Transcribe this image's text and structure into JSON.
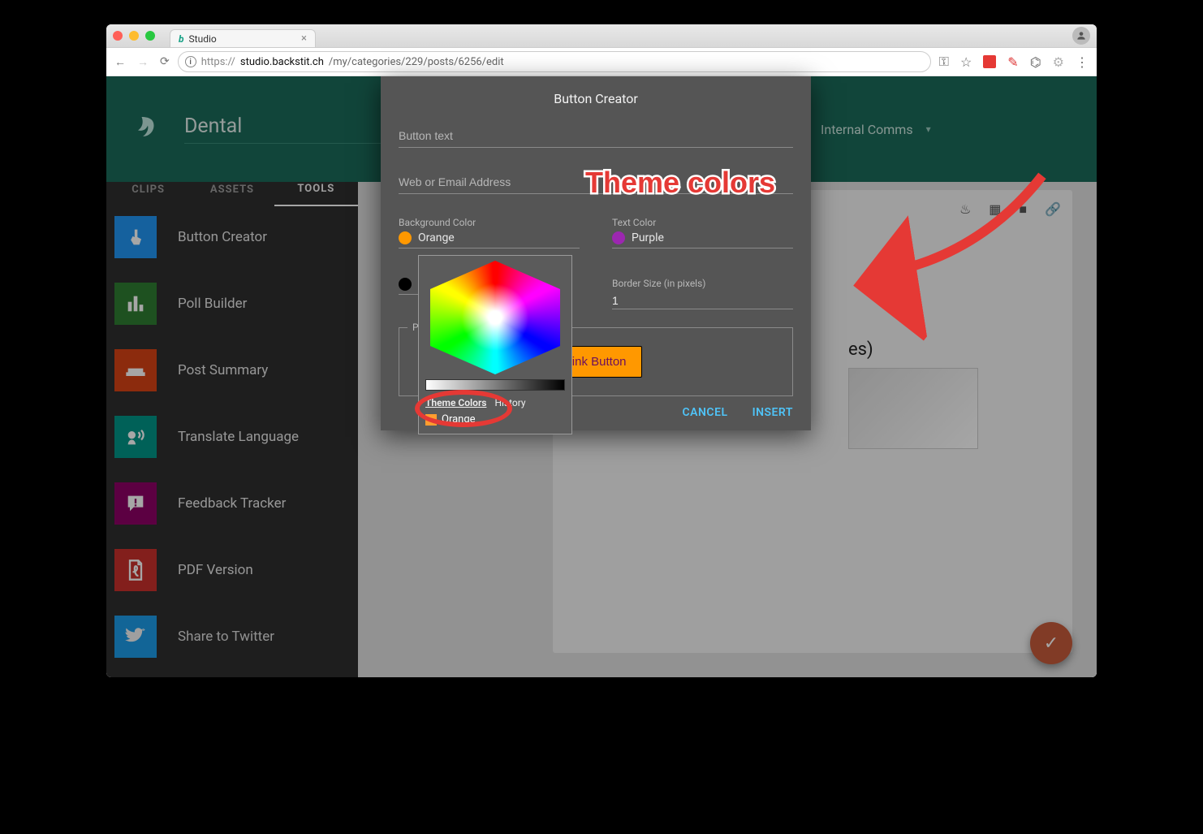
{
  "browser": {
    "tab_title": "Studio",
    "url_display_prefix": "https://",
    "url_host": "studio.backstit.ch",
    "url_path": "/my/categories/229/posts/6256/edit"
  },
  "header": {
    "site_title": "Dental",
    "profile_label": "Internal Comms"
  },
  "sidebar": {
    "tabs": {
      "clips": "CLIPS",
      "assets": "ASSETS",
      "tools": "TOOLS"
    },
    "tools": [
      {
        "label": "Button Creator",
        "icon": "pointer",
        "tile": "blue"
      },
      {
        "label": "Poll Builder",
        "icon": "bars",
        "tile": "green"
      },
      {
        "label": "Post Summary",
        "icon": "couch",
        "tile": "orange"
      },
      {
        "label": "Translate Language",
        "icon": "speak",
        "tile": "cyan"
      },
      {
        "label": "Feedback Tracker",
        "icon": "feedback",
        "tile": "purple"
      },
      {
        "label": "PDF Version",
        "icon": "pdf",
        "tile": "red"
      },
      {
        "label": "Share to Twitter",
        "icon": "twitter",
        "tile": "twitter"
      }
    ]
  },
  "modal": {
    "title": "Button Creator",
    "field_button_text_placeholder": "Button text",
    "field_address_placeholder": "Web or Email Address",
    "bg_label": "Background Color",
    "bg_value": "Orange",
    "text_label": "Text Color",
    "text_value": "Purple",
    "border_color_value": "",
    "border_size_label": "Border Size (in pixels)",
    "border_size_value": "1",
    "preview_label": "Preview",
    "preview_button_text": "Link Button",
    "cancel": "CANCEL",
    "insert": "INSERT"
  },
  "picker": {
    "tab_theme": "Theme Colors",
    "tab_history": "History",
    "swatch_label": "Orange"
  },
  "page": {
    "title_fragment": "es)"
  },
  "annotation": {
    "text": "Theme colors"
  }
}
